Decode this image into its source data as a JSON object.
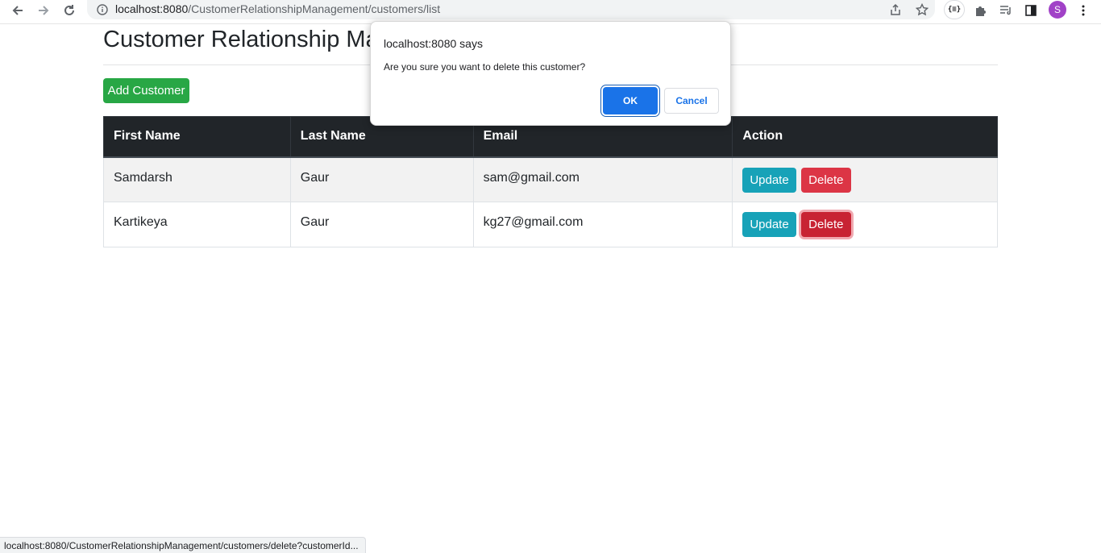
{
  "browser": {
    "url_host": "localhost:8080",
    "url_path": "/CustomerRelationshipManagement/customers/list",
    "avatar_letter": "S",
    "ext_label": "{≡}",
    "status_url": "localhost:8080/CustomerRelationshipManagement/customers/delete?customerId..."
  },
  "page": {
    "title": "Customer Relationship Ma",
    "add_button": "Add Customer"
  },
  "table": {
    "headers": [
      "First Name",
      "Last Name",
      "Email",
      "Action"
    ],
    "rows": [
      {
        "first": "Samdarsh",
        "last": "Gaur",
        "email": "sam@gmail.com",
        "update": "Update",
        "delete": "Delete"
      },
      {
        "first": "Kartikeya",
        "last": "Gaur",
        "email": "kg27@gmail.com",
        "update": "Update",
        "delete": "Delete"
      }
    ]
  },
  "dialog": {
    "title": "localhost:8080 says",
    "message": "Are you sure you want to delete this customer?",
    "ok": "OK",
    "cancel": "Cancel"
  },
  "colors": {
    "add": "#28a745",
    "update": "#17a2b8",
    "delete": "#dc3545",
    "header": "#212529",
    "dialog_ok": "#1a73e8"
  }
}
